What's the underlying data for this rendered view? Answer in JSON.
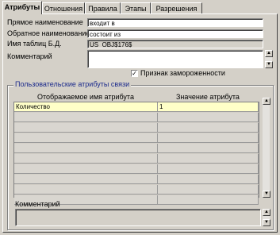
{
  "tabs": [
    {
      "label": "Атрибуты",
      "active": true
    },
    {
      "label": "Отношения",
      "active": false
    },
    {
      "label": "Правила",
      "active": false
    },
    {
      "label": "Этапы",
      "active": false
    },
    {
      "label": "Разрешения",
      "active": false
    }
  ],
  "fields": {
    "forward_name": {
      "label": "Прямое наименование",
      "value": "входит в"
    },
    "reverse_name": {
      "label": "Обратное наименование",
      "value": "состоит из"
    },
    "table_name": {
      "label": "Имя таблиц Б.Д.",
      "value": "US_OBJ$176$"
    },
    "comment": {
      "label": "Комментарий",
      "value": ""
    }
  },
  "frozen_checkbox": {
    "label": "Признак замороженности",
    "checked": true,
    "mark": "✓"
  },
  "user_attributes": {
    "group_title": "Пользовательские атрибуты связи",
    "columns": [
      "Отображаемое имя атрибута",
      "Значение атрибута"
    ],
    "rows": [
      {
        "name": "Количество",
        "value": "1"
      }
    ],
    "empty_rows": 9
  },
  "bottom_comment": {
    "label": "Комментарий",
    "value": ""
  },
  "scroll_glyphs": {
    "up": "▲",
    "down": "▼"
  }
}
